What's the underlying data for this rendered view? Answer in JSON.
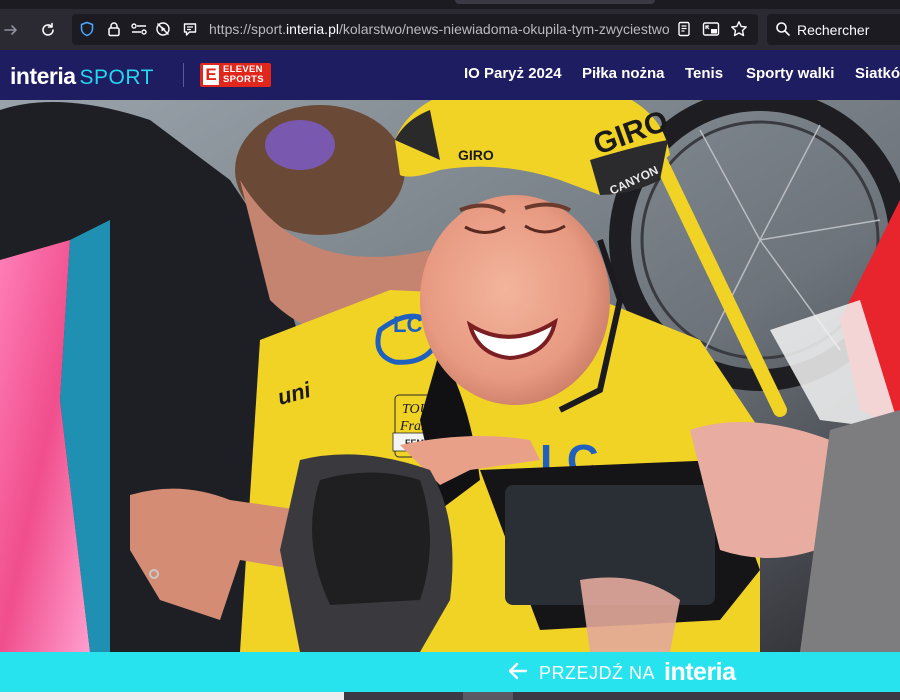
{
  "browser": {
    "url_prefix": "https://sport.",
    "url_domain": "interia.pl",
    "url_path": "/kolarstwo/news-niewiadoma-okupila-tym-zwyciestwo",
    "search_placeholder": "Rechercher",
    "icons": [
      "forward-icon",
      "reload-icon",
      "shield-icon",
      "lock-icon",
      "permissions-icon",
      "autoplay-blocked-icon",
      "message-icon",
      "reader-view-icon",
      "picture-in-picture-icon",
      "bookmark-star-icon",
      "search-icon"
    ]
  },
  "site": {
    "brand": "interia",
    "section": "SPORT",
    "partner_mark": "E",
    "partner_line1": "ELEVEN",
    "partner_line2": "SPORTS",
    "nav": [
      "IO Paryż 2024",
      "Piłka nożna",
      "Tenis",
      "Sporty walki",
      "Siatkówka"
    ]
  },
  "hero": {
    "helmet_brand": "GIRO",
    "helmet_brand_side": "GIRO",
    "helmet_sponsor": "CANYON",
    "jersey_logo": "LC",
    "jersey_text": "uni",
    "race_badge_line1": "TOUR",
    "race_badge_line2": "France",
    "race_badge_line3": "FEMMES"
  },
  "banner": {
    "cta": "PRZEJDŹ NA",
    "logo": "interia"
  },
  "colors": {
    "browser_toolbar": "#2b2a33",
    "site_nav": "#1f1d61",
    "accent_cyan": "#25d6f0",
    "eleven_red": "#e1261c",
    "banner": "#27e3ee",
    "jersey_yellow": "#f1d326"
  }
}
